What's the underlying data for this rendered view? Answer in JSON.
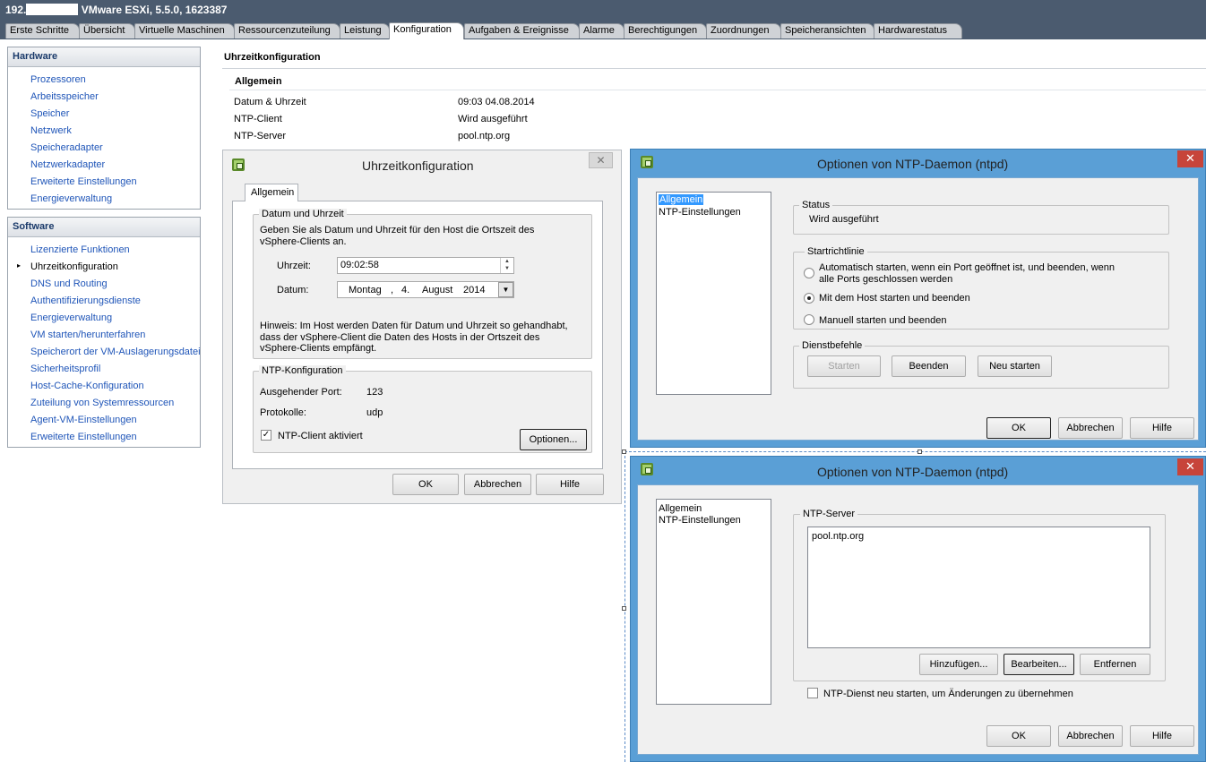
{
  "window": {
    "host_ip": "192.",
    "title": "VMware ESXi, 5.5.0, 1623387"
  },
  "tabs": [
    "Erste Schritte",
    "Übersicht",
    "Virtuelle Maschinen",
    "Ressourcenzuteilung",
    "Leistung",
    "Konfiguration",
    "Aufgaben & Ereignisse",
    "Alarme",
    "Berechtigungen",
    "Zuordnungen",
    "Speicheransichten",
    "Hardwarestatus"
  ],
  "active_tab": "Konfiguration",
  "hardware": {
    "title": "Hardware",
    "items": [
      "Prozessoren",
      "Arbeitsspeicher",
      "Speicher",
      "Netzwerk",
      "Speicheradapter",
      "Netzwerkadapter",
      "Erweiterte Einstellungen",
      "Energieverwaltung"
    ]
  },
  "software": {
    "title": "Software",
    "items": [
      "Lizenzierte Funktionen",
      "Uhrzeitkonfiguration",
      "DNS und Routing",
      "Authentifizierungsdienste",
      "Energieverwaltung",
      "VM starten/herunterfahren",
      "Speicherort der VM-Auslagerungsdatei",
      "Sicherheitsprofil",
      "Host-Cache-Konfiguration",
      "Zuteilung von Systemressourcen",
      "Agent-VM-Einstellungen",
      "Erweiterte Einstellungen"
    ],
    "selected": "Uhrzeitkonfiguration"
  },
  "main": {
    "heading": "Uhrzeitkonfiguration",
    "section": "Allgemein",
    "rows": [
      {
        "label": "Datum & Uhrzeit",
        "value": "09:03  04.08.2014"
      },
      {
        "label": "NTP-Client",
        "value": "Wird ausgeführt"
      },
      {
        "label": "NTP-Server",
        "value": "pool.ntp.org"
      }
    ]
  },
  "time_dialog": {
    "title": "Uhrzeitkonfiguration",
    "close": "✕",
    "tab": "Allgemein",
    "date_group": "Datum und Uhrzeit",
    "desc": [
      "Geben Sie als Datum und Uhrzeit für den Host die Ortszeit des",
      "vSphere-Clients an."
    ],
    "time_label": "Uhrzeit:",
    "time_value": "09:02:58",
    "date_label": "Datum:",
    "date_weekday": "Montag",
    "date_sep": ",",
    "date_day": "4.",
    "date_month": "August",
    "date_year": "2014",
    "hint": [
      "Hinweis: Im Host werden Daten für Datum und Uhrzeit so gehandhabt,",
      "dass der vSphere-Client die Daten des Hosts in der Ortszeit des",
      "vSphere-Clients empfängt."
    ],
    "ntp_group": "NTP-Konfiguration",
    "port_label": "Ausgehender Port:",
    "port_value": "123",
    "proto_label": "Protokolle:",
    "proto_value": "udp",
    "ntp_enabled_label": "NTP-Client aktiviert",
    "ntp_enabled": true,
    "options_button": "Optionen...",
    "ok": "OK",
    "cancel": "Abbrechen",
    "help": "Hilfe"
  },
  "ntp_dialog_1": {
    "title": "Optionen von NTP-Daemon (ntpd)",
    "close": "✕",
    "nav": [
      "Allgemein",
      "NTP-Einstellungen"
    ],
    "nav_selected": "Allgemein",
    "status_group": "Status",
    "status_value": "Wird ausgeführt",
    "policy_group": "Startrichtlinie",
    "policy_options": [
      [
        "Automatisch starten, wenn ein Port geöffnet ist, und beenden, wenn",
        "alle Ports geschlossen werden"
      ],
      [
        "Mit dem Host starten und beenden"
      ],
      [
        "Manuell starten und beenden"
      ]
    ],
    "policy_selected": 1,
    "commands_group": "Dienstbefehle",
    "start": "Starten",
    "stop": "Beenden",
    "restart": "Neu starten",
    "ok": "OK",
    "cancel": "Abbrechen",
    "help": "Hilfe"
  },
  "ntp_dialog_2": {
    "title": "Optionen von NTP-Daemon (ntpd)",
    "close": "✕",
    "nav": [
      "Allgemein",
      "NTP-Einstellungen"
    ],
    "server_group": "NTP-Server",
    "servers": [
      "pool.ntp.org"
    ],
    "add": "Hinzufügen...",
    "edit": "Bearbeiten...",
    "remove": "Entfernen",
    "restart_label": "NTP-Dienst neu starten, um Änderungen zu übernehmen",
    "restart_checked": false,
    "ok": "OK",
    "cancel": "Abbrechen",
    "help": "Hilfe"
  },
  "colors": {
    "header": "#4b5b6f",
    "link": "#1f55b8",
    "dialog_frame": "#5a9fd6",
    "close_red": "#c7443a"
  }
}
